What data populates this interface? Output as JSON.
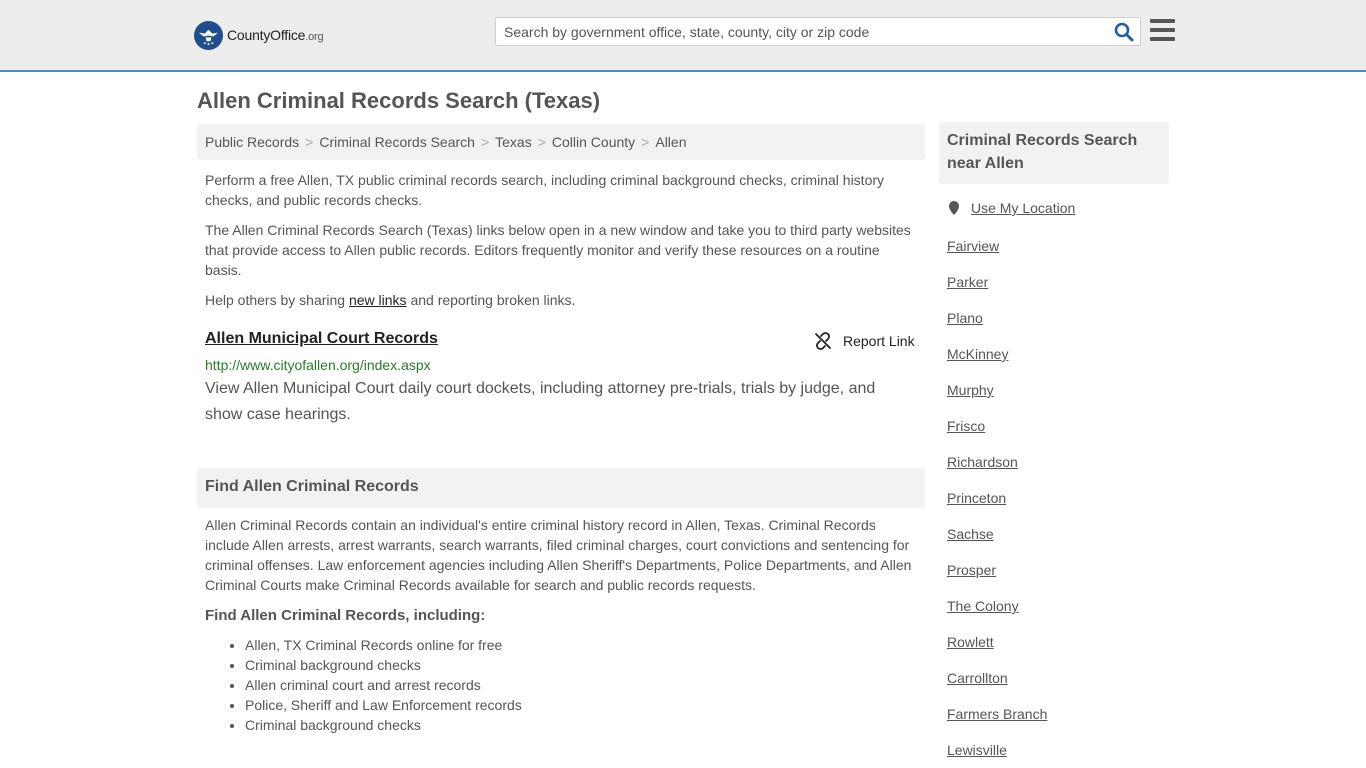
{
  "header": {
    "logo_main": "CountyOffice",
    "logo_tld": ".org",
    "search_placeholder": "Search by government office, state, county, city or zip code",
    "search_value": ""
  },
  "page": {
    "title": "Allen Criminal Records Search (Texas)",
    "breadcrumb": [
      "Public Records",
      "Criminal Records Search",
      "Texas",
      "Collin County",
      "Allen"
    ],
    "intro": "Perform a free Allen, TX public criminal records search, including criminal background checks, criminal history checks, and public records checks.",
    "disclaimer": "The Allen Criminal Records Search (Texas) links below open in a new window and take you to third party websites that provide access to Allen public records. Editors frequently monitor and verify these resources on a routine basis.",
    "help_before": "Help others by sharing ",
    "help_link": "new links",
    "help_after": " and reporting broken links."
  },
  "record": {
    "title": "Allen Municipal Court Records",
    "report_label": "Report Link",
    "url": "http://www.cityofallen.org/index.aspx",
    "description": "View Allen Municipal Court daily court dockets, including attorney pre-trials, trials by judge, and show case hearings."
  },
  "find_section": {
    "heading": "Find Allen Criminal Records",
    "body": "Allen Criminal Records contain an individual's entire criminal history record in Allen, Texas. Criminal Records include Allen arrests, arrest warrants, search warrants, filed criminal charges, court convictions and sentencing for criminal offenses. Law enforcement agencies including Allen Sheriff's Departments, Police Departments, and Allen Criminal Courts make Criminal Records available for search and public records requests.",
    "subheading": "Find Allen Criminal Records, including:",
    "items": [
      "Allen, TX Criminal Records online for free",
      "Criminal background checks",
      "Allen criminal court and arrest records",
      "Police, Sheriff and Law Enforcement records",
      "Criminal background checks"
    ]
  },
  "sidebar": {
    "heading": "Criminal Records Search near Allen",
    "use_location": "Use My Location",
    "cities": [
      "Fairview",
      "Parker",
      "Plano",
      "McKinney",
      "Murphy",
      "Frisco",
      "Richardson",
      "Princeton",
      "Sachse",
      "Prosper",
      "The Colony",
      "Rowlett",
      "Carrollton",
      "Farmers Branch",
      "Lewisville"
    ]
  },
  "colors": {
    "accent_border": "#4a8ac9",
    "logo_blue": "#1e4e8c",
    "url_green": "#2a7a2a",
    "panel_gray": "#f2f2f2",
    "header_gray": "#ededed"
  },
  "icons": [
    "search-icon",
    "menu-icon",
    "broken-link-icon",
    "location-pin-icon",
    "eagle-logo-icon"
  ]
}
